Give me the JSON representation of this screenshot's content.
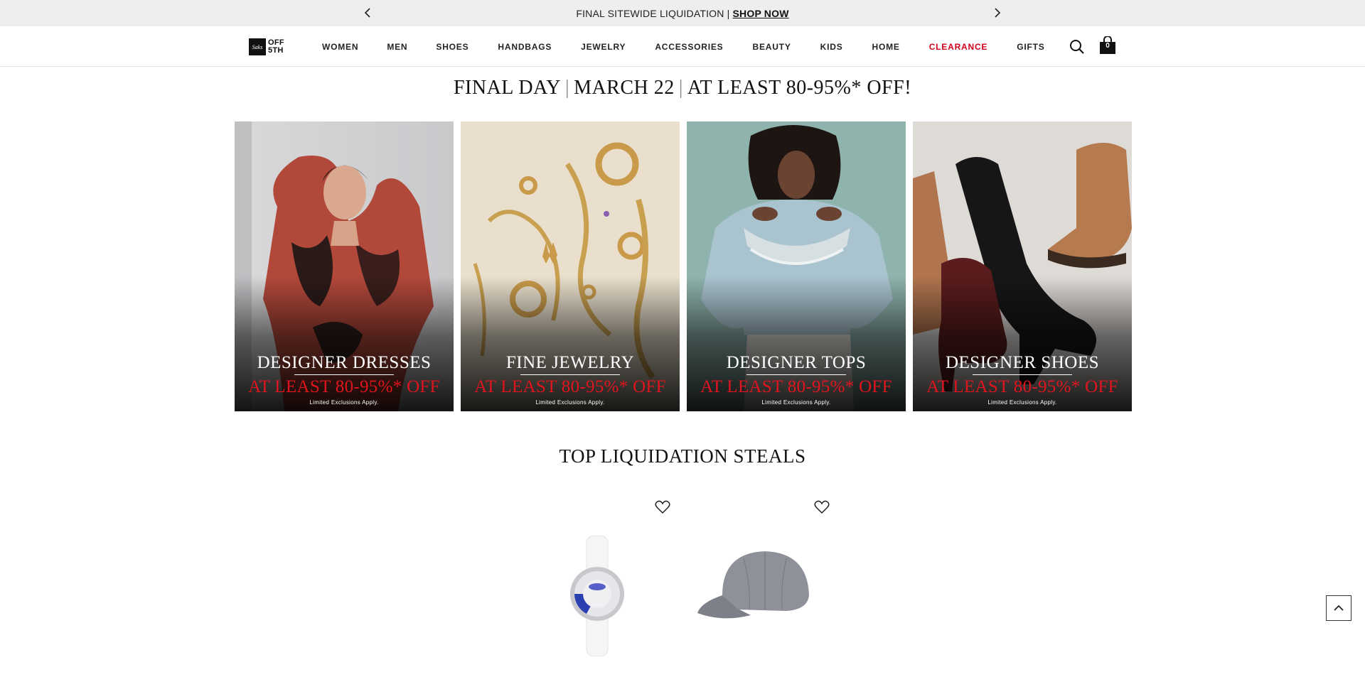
{
  "promo": {
    "text": "FINAL SITEWIDE LIQUIDATION |",
    "link": "SHOP NOW"
  },
  "nav": {
    "logo_top": "OFF",
    "logo_bottom": "5TH",
    "logo_mark": "Saks",
    "items": [
      "WOMEN",
      "MEN",
      "SHOES",
      "HANDBAGS",
      "JEWELRY",
      "ACCESSORIES",
      "BEAUTY",
      "KIDS",
      "HOME",
      "CLEARANCE",
      "GIFTS"
    ],
    "bag_count": "0",
    "clearance_color": "#d0021b"
  },
  "headline": {
    "part1": "FINAL DAY",
    "part2": "MARCH 22",
    "part3": "AT LEAST 80-95%* OFF!"
  },
  "tiles": [
    {
      "title": "DESIGNER DRESSES",
      "offer": "AT LEAST 80-95%* OFF",
      "note": "Limited Exclusions Apply."
    },
    {
      "title": "FINE JEWELRY",
      "offer": "AT LEAST 80-95%* OFF",
      "note": "Limited Exclusions Apply."
    },
    {
      "title": "DESIGNER TOPS",
      "offer": "AT LEAST 80-95%* OFF",
      "note": "Limited Exclusions Apply."
    },
    {
      "title": "DESIGNER SHOES",
      "offer": "AT LEAST 80-95%* OFF",
      "note": "Limited Exclusions Apply."
    }
  ],
  "steals": {
    "title": "TOP LIQUIDATION STEALS"
  },
  "colors": {
    "offer_red": "#e0141e",
    "promo_bg": "#eeeeee"
  }
}
